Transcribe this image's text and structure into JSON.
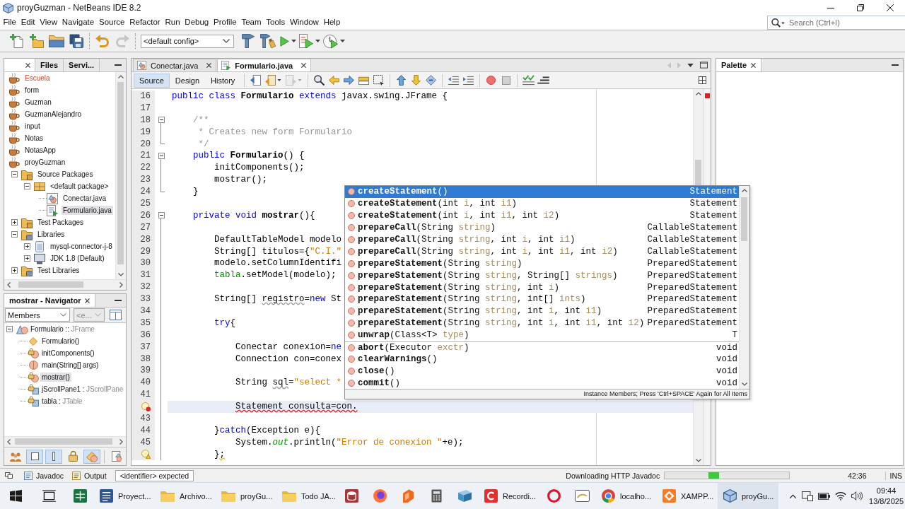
{
  "window": {
    "title": "proyGuzman - NetBeans IDE 8.2"
  },
  "menu": [
    "File",
    "Edit",
    "View",
    "Navigate",
    "Source",
    "Refactor",
    "Run",
    "Debug",
    "Profile",
    "Team",
    "Tools",
    "Window",
    "Help"
  ],
  "search": {
    "placeholder": "Search (Ctrl+I)"
  },
  "toolbar": {
    "buttons": [
      {
        "kind": "new-file",
        "disabled": false
      },
      {
        "kind": "new-project",
        "disabled": false
      },
      {
        "kind": "open-project",
        "disabled": false
      },
      {
        "kind": "save-all",
        "disabled": false
      },
      {
        "kind": "undo",
        "disabled": false
      },
      {
        "kind": "redo",
        "disabled": true
      }
    ],
    "config": "<default config>",
    "actions": [
      {
        "kind": "build",
        "disabled": false
      },
      {
        "kind": "clean-build",
        "disabled": false
      },
      {
        "kind": "run",
        "disabled": false,
        "menu": true
      },
      {
        "kind": "debug",
        "disabled": false,
        "menu": true
      },
      {
        "kind": "profile",
        "disabled": false,
        "menu": true
      }
    ]
  },
  "projects": {
    "tabs": [
      {
        "selected": true
      },
      {
        "label": "Files",
        "selected": false
      },
      {
        "label": "Servi...",
        "selected": false
      }
    ],
    "tree": [
      {
        "label": "Escuela",
        "kind": "project",
        "error": true,
        "selected": false
      },
      {
        "label": "form",
        "kind": "project",
        "error": false,
        "selected": false
      },
      {
        "label": "Guzman",
        "kind": "project",
        "error": false,
        "selected": false
      },
      {
        "label": "GuzmanAlejandro",
        "kind": "project",
        "error": false,
        "selected": false
      },
      {
        "label": "input",
        "kind": "project",
        "error": false,
        "selected": false
      },
      {
        "label": "Notas",
        "kind": "project",
        "error": false,
        "selected": false
      },
      {
        "label": "NotasApp",
        "kind": "project",
        "error": false,
        "selected": false
      },
      {
        "label": "proyGuzman",
        "kind": "project",
        "error": false,
        "selected": false,
        "children": [
          {
            "label": "Source Packages",
            "kind": "source-folder",
            "expanded": true,
            "selected": false,
            "children": [
              {
                "label": "<default package>",
                "kind": "package",
                "expanded": true,
                "selected": false,
                "children": [
                  {
                    "label": "Conectar.java",
                    "kind": "class-file",
                    "selected": false
                  },
                  {
                    "label": "Formulario.java",
                    "kind": "form-file",
                    "selected": true
                  }
                ]
              }
            ]
          },
          {
            "label": "Test Packages",
            "kind": "source-folder",
            "expanded": false,
            "selected": false
          },
          {
            "label": "Libraries",
            "kind": "library-folder",
            "expanded": true,
            "selected": false,
            "children": [
              {
                "label": "mysql-connector-j-8",
                "kind": "jar",
                "expanded": false,
                "selected": false
              },
              {
                "label": "JDK 1.8 (Default)",
                "kind": "jdk",
                "expanded": false,
                "selected": false
              }
            ]
          },
          {
            "label": "Test Libraries",
            "kind": "library-folder",
            "expanded": false,
            "selected": false
          }
        ]
      }
    ]
  },
  "navigator": {
    "title": "mostrar - Navigator",
    "filters": [
      {
        "value": "Members",
        "disabled": false
      },
      {
        "value": "<e...",
        "disabled": true
      }
    ],
    "tree": [
      {
        "label": "Formulario",
        "separator": "::",
        "type": "JFrame",
        "kind": "class",
        "expanded": true,
        "selected": false,
        "children": [
          {
            "label": "Formulario()",
            "kind": "constructor",
            "selected": false
          },
          {
            "label": "initComponents()",
            "kind": "private-method",
            "selected": false
          },
          {
            "label": "main(String[] args)",
            "kind": "static-method",
            "selected": false
          },
          {
            "label": "mostrar()",
            "kind": "private-method",
            "selected": true
          },
          {
            "label": "jScrollPane1",
            "separator": ":",
            "type": "JScrollPane",
            "kind": "private-field",
            "selected": false
          },
          {
            "label": "tabla",
            "separator": ":",
            "type": "JTable",
            "kind": "private-field",
            "selected": false
          }
        ]
      }
    ],
    "buttons": [
      {
        "kind": "inherited",
        "selected": false
      },
      {
        "kind": "fields",
        "selected": true
      },
      {
        "kind": "static",
        "selected": true
      },
      {
        "kind": "non-public",
        "selected": false
      },
      {
        "kind": "local-classes",
        "selected": true
      },
      {
        "kind": "javadoc",
        "selected": false
      }
    ]
  },
  "editor": {
    "tabs": [
      {
        "label": "Conectar.java",
        "kind": "class",
        "selected": false
      },
      {
        "label": "Formulario.java",
        "kind": "form",
        "selected": true
      }
    ],
    "views": [
      {
        "label": "Source",
        "selected": true
      },
      {
        "label": "Design",
        "selected": false
      },
      {
        "label": "History",
        "selected": false
      }
    ],
    "tool_groups": [
      [
        {
          "kind": "last-edit",
          "disabled": false
        },
        {
          "kind": "back",
          "disabled": false,
          "menu": true
        },
        {
          "kind": "forward",
          "disabled": true,
          "menu": true
        }
      ],
      [
        {
          "kind": "find-selection",
          "disabled": false
        },
        {
          "kind": "find-previous",
          "disabled": false
        },
        {
          "kind": "find-next",
          "disabled": false
        },
        {
          "kind": "toggle-highlight",
          "disabled": false
        },
        {
          "kind": "rectangular-selection",
          "disabled": false
        }
      ],
      [
        {
          "kind": "previous-bookmark",
          "disabled": false
        },
        {
          "kind": "next-bookmark",
          "disabled": false
        },
        {
          "kind": "toggle-bookmark",
          "disabled": false
        }
      ],
      [
        {
          "kind": "shift-left",
          "disabled": false
        },
        {
          "kind": "shift-right",
          "disabled": false
        }
      ],
      [
        {
          "kind": "start-macro",
          "disabled": false
        },
        {
          "kind": "stop-macro",
          "disabled": false
        }
      ],
      [
        {
          "kind": "check",
          "disabled": false
        },
        {
          "kind": "validate",
          "disabled": false
        }
      ]
    ],
    "lines": [
      {
        "number": "16",
        "current": false,
        "tokens": [
          {
            "kind": "keyword",
            "text": "public class "
          },
          {
            "kind": "declaration",
            "text": "Formulario"
          },
          {
            "kind": "keyword",
            "text": " extends "
          },
          {
            "kind": "plain",
            "text": "javax.swing.JFrame {"
          }
        ]
      },
      {
        "number": "17",
        "current": false
      },
      {
        "number": "18",
        "fold": {
          "kind": "start"
        },
        "current": false,
        "tokens": [
          {
            "kind": "comment",
            "text": "    /**"
          }
        ]
      },
      {
        "number": "19",
        "fold": {
          "kind": "line"
        },
        "current": false,
        "tokens": [
          {
            "kind": "comment",
            "text": "     * Creates new form Formulario"
          }
        ]
      },
      {
        "number": "20",
        "fold": {
          "kind": "end"
        },
        "current": false,
        "tokens": [
          {
            "kind": "comment",
            "text": "     */"
          }
        ]
      },
      {
        "number": "21",
        "fold": {
          "kind": "start"
        },
        "current": false,
        "tokens": [
          {
            "kind": "keyword",
            "text": "    public "
          },
          {
            "kind": "declaration",
            "text": "Formulario"
          },
          {
            "kind": "plain",
            "text": "() {"
          }
        ]
      },
      {
        "number": "22",
        "fold": {
          "kind": "line"
        },
        "current": false,
        "tokens": [
          {
            "kind": "plain",
            "text": "        initComponents();"
          }
        ]
      },
      {
        "number": "23",
        "fold": {
          "kind": "line"
        },
        "current": false,
        "tokens": [
          {
            "kind": "plain",
            "text": "        mostrar();"
          }
        ]
      },
      {
        "number": "24",
        "fold": {
          "kind": "end"
        },
        "current": false,
        "tokens": [
          {
            "kind": "plain",
            "text": "    }"
          }
        ]
      },
      {
        "number": "25",
        "current": false
      },
      {
        "number": "26",
        "fold": {
          "kind": "start"
        },
        "current": false,
        "tokens": [
          {
            "kind": "keyword",
            "text": "    private void "
          },
          {
            "kind": "declaration",
            "text": "mostrar"
          },
          {
            "kind": "plain",
            "text": "(){"
          }
        ]
      },
      {
        "number": "27",
        "fold": {
          "kind": "line"
        },
        "current": false
      },
      {
        "number": "28",
        "fold": {
          "kind": "line"
        },
        "current": false,
        "tokens": [
          {
            "kind": "plain",
            "text": "        DefaultTableModel modelo"
          }
        ]
      },
      {
        "number": "29",
        "fold": {
          "kind": "line"
        },
        "current": false,
        "tokens": [
          {
            "kind": "plain",
            "text": "        String[] titulos={"
          },
          {
            "kind": "string",
            "text": "\"C.I.\""
          }
        ]
      },
      {
        "number": "30",
        "fold": {
          "kind": "line"
        },
        "current": false,
        "tokens": [
          {
            "kind": "plain",
            "text": "        modelo.setColumnIdentifi"
          }
        ]
      },
      {
        "number": "31",
        "fold": {
          "kind": "line"
        },
        "current": false,
        "tokens": [
          {
            "kind": "field",
            "text": "        tabla"
          },
          {
            "kind": "plain",
            "text": ".setModel(modelo);"
          }
        ]
      },
      {
        "number": "32",
        "fold": {
          "kind": "line"
        },
        "current": false
      },
      {
        "number": "33",
        "fold": {
          "kind": "line"
        },
        "current": false,
        "tokens": [
          {
            "kind": "plain",
            "text": "        String[] "
          },
          {
            "kind": "warning",
            "text": "registro"
          },
          {
            "kind": "plain",
            "text": "="
          },
          {
            "kind": "keyword",
            "text": "new"
          },
          {
            "kind": "plain",
            "text": " St"
          }
        ]
      },
      {
        "number": "34",
        "fold": {
          "kind": "line"
        },
        "current": false
      },
      {
        "number": "35",
        "fold": {
          "kind": "line"
        },
        "current": false,
        "tokens": [
          {
            "kind": "keyword",
            "text": "        try"
          },
          {
            "kind": "plain",
            "text": "{"
          }
        ]
      },
      {
        "number": "36",
        "fold": {
          "kind": "line"
        },
        "current": false
      },
      {
        "number": "37",
        "fold": {
          "kind": "line"
        },
        "current": false,
        "tokens": [
          {
            "kind": "plain",
            "text": "            Conectar conexion="
          },
          {
            "kind": "keyword",
            "text": "ne"
          }
        ]
      },
      {
        "number": "38",
        "fold": {
          "kind": "line"
        },
        "current": false,
        "tokens": [
          {
            "kind": "plain",
            "text": "            Connection con=conex"
          }
        ]
      },
      {
        "number": "39",
        "fold": {
          "kind": "line"
        },
        "current": false
      },
      {
        "number": "40",
        "fold": {
          "kind": "line"
        },
        "current": false,
        "tokens": [
          {
            "kind": "plain",
            "text": "            String "
          },
          {
            "kind": "warning",
            "text": "sql"
          },
          {
            "kind": "plain",
            "text": "="
          },
          {
            "kind": "string",
            "text": "\"select *"
          }
        ]
      },
      {
        "number": "41",
        "fold": {
          "kind": "line"
        },
        "current": false
      },
      {
        "marker": {
          "kind": "error"
        },
        "fold": {
          "kind": "line"
        },
        "current": true,
        "tokens": [
          {
            "kind": "error",
            "text": "            Statement consulta=con."
          }
        ]
      },
      {
        "number": "43",
        "fold": {
          "kind": "line"
        },
        "current": false
      },
      {
        "number": "44",
        "fold": {
          "kind": "line"
        },
        "current": false,
        "tokens": [
          {
            "kind": "plain",
            "text": "        }"
          },
          {
            "kind": "keyword",
            "text": "catch"
          },
          {
            "kind": "plain",
            "text": "(Exception e){"
          }
        ]
      },
      {
        "number": "45",
        "fold": {
          "kind": "line"
        },
        "current": false,
        "tokens": [
          {
            "kind": "plain",
            "text": "            System."
          },
          {
            "kind": "static-field",
            "text": "out"
          },
          {
            "kind": "plain",
            "text": ".println("
          },
          {
            "kind": "string",
            "text": "\"Error de conexion \""
          },
          {
            "kind": "plain",
            "text": "+e);"
          }
        ]
      },
      {
        "marker": {
          "kind": "warning"
        },
        "fold": {
          "kind": "line"
        },
        "current": false,
        "tokens": [
          {
            "kind": "plain",
            "text": "        }"
          },
          {
            "kind": "hint",
            "text": ";"
          }
        ]
      }
    ],
    "completion": {
      "groups": [
        [
          {
            "name": "createStatement",
            "params": [
              "()"
            ],
            "returns": "Statement",
            "selected": true
          },
          {
            "name": "createStatement",
            "params": [
              "(int ",
              "i",
              ", int ",
              "i1",
              ")"
            ],
            "returns": "Statement",
            "selected": false
          },
          {
            "name": "createStatement",
            "params": [
              "(int ",
              "i",
              ", int ",
              "i1",
              ", int ",
              "i2",
              ")"
            ],
            "returns": "Statement",
            "selected": false
          },
          {
            "name": "prepareCall",
            "params": [
              "(String ",
              "string",
              ")"
            ],
            "returns": "CallableStatement",
            "selected": false
          },
          {
            "name": "prepareCall",
            "params": [
              "(String ",
              "string",
              ", int ",
              "i",
              ", int ",
              "i1",
              ")"
            ],
            "returns": "CallableStatement",
            "selected": false
          },
          {
            "name": "prepareCall",
            "params": [
              "(String ",
              "string",
              ", int ",
              "i",
              ", int ",
              "i1",
              ", int ",
              "i2",
              ")"
            ],
            "returns": "CallableStatement",
            "selected": false
          },
          {
            "name": "prepareStatement",
            "params": [
              "(String ",
              "string",
              ")"
            ],
            "returns": "PreparedStatement",
            "selected": false
          },
          {
            "name": "prepareStatement",
            "params": [
              "(String ",
              "string",
              ", String[] ",
              "strings",
              ")"
            ],
            "returns": "PreparedStatement",
            "selected": false
          },
          {
            "name": "prepareStatement",
            "params": [
              "(String ",
              "string",
              ", int ",
              "i",
              ")"
            ],
            "returns": "PreparedStatement",
            "selected": false
          },
          {
            "name": "prepareStatement",
            "params": [
              "(String ",
              "string",
              ", int[] ",
              "ints",
              ")"
            ],
            "returns": "PreparedStatement",
            "selected": false
          },
          {
            "name": "prepareStatement",
            "params": [
              "(String ",
              "string",
              ", int ",
              "i",
              ", int ",
              "i1",
              ")"
            ],
            "returns": "PreparedStatement",
            "selected": false
          },
          {
            "name": "prepareStatement",
            "params": [
              "(String ",
              "string",
              ", int ",
              "i",
              ", int ",
              "i1",
              ", int ",
              "i2",
              ")"
            ],
            "returns": "PreparedStatement",
            "selected": false
          },
          {
            "name": "unwrap",
            "params": [
              "(Class<T> ",
              "type",
              ")"
            ],
            "returns": "T",
            "selected": false
          }
        ],
        [
          {
            "name": "abort",
            "params": [
              "(Executor ",
              "exctr",
              ")"
            ],
            "returns": "void",
            "selected": false
          },
          {
            "name": "clearWarnings",
            "params": [
              "()"
            ],
            "returns": "void",
            "selected": false
          },
          {
            "name": "close",
            "params": [
              "()"
            ],
            "returns": "void",
            "selected": false
          },
          {
            "name": "commit",
            "params": [
              "()"
            ],
            "returns": "void",
            "selected": false
          }
        ]
      ],
      "footer": "Instance Members; Press 'Ctrl+SPACE' Again for All Items"
    }
  },
  "palette": {
    "title": "Palette"
  },
  "status_bar": {
    "tabs": [
      {
        "label": "Javadoc",
        "kind": "javadoc"
      },
      {
        "label": "Output",
        "kind": "output"
      }
    ],
    "message": "<identifier> expected",
    "task": "Downloading HTTP Javadoc",
    "busy": true,
    "position": "42:36",
    "mode": "INS"
  },
  "taskbar": {
    "apps": [
      {
        "kind": "spreadsheet",
        "selected": false
      },
      {
        "kind": "document",
        "label": "Proyect...",
        "selected": false
      },
      {
        "kind": "folder",
        "label": "Archivo...",
        "selected": false
      },
      {
        "kind": "folder",
        "label": "proyGu...",
        "selected": false
      },
      {
        "kind": "folder",
        "label": "Todo JA...",
        "selected": false
      },
      {
        "kind": "database",
        "selected": false
      },
      {
        "kind": "fox-browser",
        "selected": false
      },
      {
        "kind": "orange-app",
        "selected": false
      },
      {
        "kind": "calculator",
        "selected": false
      },
      {
        "kind": "notepad",
        "selected": false
      },
      {
        "kind": "recorder",
        "label": "Recordi...",
        "selected": false
      },
      {
        "kind": "ring-browser",
        "selected": false
      },
      {
        "kind": "scanner",
        "selected": false
      },
      {
        "kind": "browser",
        "label": "localho...",
        "selected": false
      },
      {
        "kind": "xampp",
        "label": "XAMPP...",
        "selected": false
      },
      {
        "kind": "netbeans",
        "label": "proyGu...",
        "selected": true
      }
    ],
    "time": "09:44",
    "date": "13/8/2025"
  }
}
